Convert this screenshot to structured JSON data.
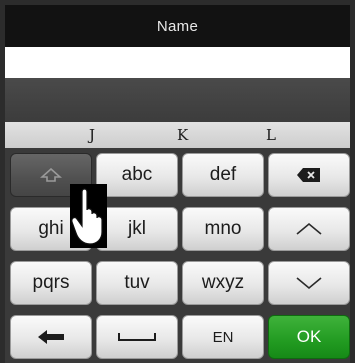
{
  "header": {
    "title": "Name"
  },
  "input": {
    "value": "",
    "placeholder": ""
  },
  "hints": {
    "letters": [
      "J",
      "K",
      "L"
    ]
  },
  "keyboard": {
    "row1": {
      "shift_icon": "shift-up-arrow-icon",
      "abc": "abc",
      "def": "def",
      "backspace_icon": "backspace-icon"
    },
    "row2": {
      "ghi": "ghi",
      "jkl": "jkl",
      "mno": "mno",
      "up_icon": "chevron-up-icon"
    },
    "row3": {
      "pqrs": "pqrs",
      "tuv": "tuv",
      "wxyz": "wxyz",
      "down_icon": "chevron-down-icon"
    },
    "row4": {
      "back_icon": "back-arrow-icon",
      "space_icon": "space-bar-icon",
      "lang": "EN",
      "ok": "OK"
    }
  },
  "colors": {
    "ok_green": "#229b21",
    "title_bg": "#121212",
    "pressed_key": "#505050"
  }
}
